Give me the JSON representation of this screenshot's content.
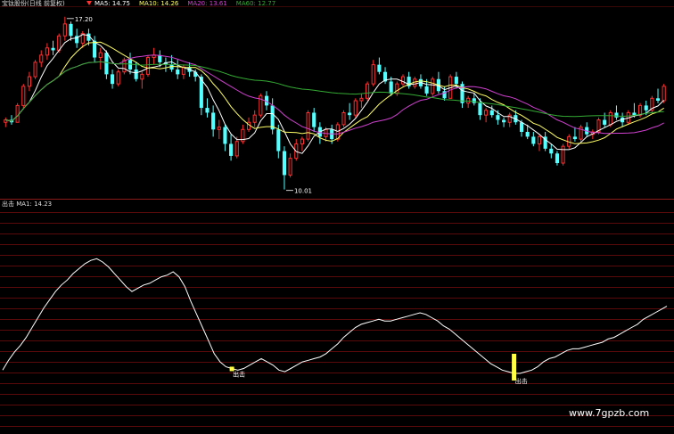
{
  "chart_data": [
    {
      "type": "candlestick",
      "title": "宝钛股份(日线 前复权)",
      "ma_legend": [
        {
          "label": "MA5: 14.75",
          "color": "#ffffff"
        },
        {
          "label": "MA10: 14.26",
          "color": "#ffff66"
        },
        {
          "label": "MA20: 13.61",
          "color": "#d040d0"
        },
        {
          "label": "MA60: 12.77",
          "color": "#33aa33"
        }
      ],
      "annotations": {
        "high": "17.20",
        "low": "10.01"
      },
      "ylim": [
        9.8,
        17.6
      ],
      "colors": {
        "up": "#ff3030",
        "down": "#54ffff",
        "grid": "#5a0a0a",
        "divider": "#8a1a1a"
      },
      "candles": [
        [
          12.8,
          13.0,
          12.6,
          12.9
        ],
        [
          12.9,
          13.1,
          12.7,
          12.8
        ],
        [
          12.8,
          13.6,
          12.8,
          13.5
        ],
        [
          13.5,
          14.4,
          13.4,
          14.3
        ],
        [
          14.3,
          14.9,
          14.1,
          14.7
        ],
        [
          14.7,
          15.4,
          14.6,
          15.3
        ],
        [
          15.3,
          15.8,
          15.1,
          15.6
        ],
        [
          15.6,
          16.1,
          15.4,
          15.9
        ],
        [
          15.9,
          16.2,
          15.6,
          15.8
        ],
        [
          15.8,
          16.5,
          15.7,
          16.4
        ],
        [
          16.4,
          17.2,
          16.2,
          16.9
        ],
        [
          16.9,
          17.0,
          16.2,
          16.4
        ],
        [
          16.4,
          16.7,
          15.9,
          16.1
        ],
        [
          16.1,
          16.6,
          15.9,
          16.5
        ],
        [
          16.5,
          16.7,
          16.0,
          16.2
        ],
        [
          16.2,
          16.4,
          15.3,
          15.5
        ],
        [
          15.5,
          15.9,
          15.0,
          15.7
        ],
        [
          15.7,
          15.8,
          14.6,
          14.8
        ],
        [
          14.8,
          15.0,
          14.2,
          14.4
        ],
        [
          14.4,
          15.0,
          14.3,
          14.9
        ],
        [
          14.9,
          15.5,
          14.8,
          15.4
        ],
        [
          15.4,
          15.7,
          14.8,
          15.0
        ],
        [
          15.0,
          15.3,
          14.5,
          14.6
        ],
        [
          14.6,
          14.9,
          14.2,
          14.8
        ],
        [
          14.8,
          15.6,
          14.7,
          15.5
        ],
        [
          15.5,
          15.9,
          15.2,
          15.6
        ],
        [
          15.6,
          15.8,
          15.1,
          15.3
        ],
        [
          15.3,
          15.5,
          14.9,
          15.2
        ],
        [
          15.2,
          15.6,
          14.9,
          15.0
        ],
        [
          15.0,
          15.4,
          14.6,
          14.8
        ],
        [
          14.8,
          15.2,
          14.6,
          15.1
        ],
        [
          15.1,
          15.3,
          14.7,
          14.9
        ],
        [
          14.9,
          15.0,
          14.5,
          14.7
        ],
        [
          14.7,
          14.8,
          13.1,
          13.4
        ],
        [
          13.4,
          13.8,
          13.0,
          13.2
        ],
        [
          13.2,
          13.5,
          12.2,
          12.5
        ],
        [
          12.5,
          12.9,
          12.1,
          12.6
        ],
        [
          12.6,
          12.7,
          11.6,
          11.9
        ],
        [
          11.9,
          12.3,
          11.2,
          11.4
        ],
        [
          11.4,
          12.2,
          11.3,
          12.0
        ],
        [
          12.0,
          12.7,
          11.9,
          12.5
        ],
        [
          12.5,
          13.0,
          12.4,
          12.8
        ],
        [
          12.8,
          13.3,
          12.6,
          13.1
        ],
        [
          13.1,
          14.0,
          13.0,
          13.9
        ],
        [
          13.9,
          14.1,
          13.3,
          13.5
        ],
        [
          13.5,
          13.8,
          12.3,
          12.5
        ],
        [
          12.5,
          12.7,
          11.3,
          11.6
        ],
        [
          11.6,
          11.8,
          10.0,
          10.6
        ],
        [
          10.6,
          11.5,
          10.5,
          11.3
        ],
        [
          11.3,
          12.1,
          11.2,
          11.9
        ],
        [
          11.9,
          12.2,
          11.6,
          12.1
        ],
        [
          12.1,
          13.3,
          12.0,
          13.2
        ],
        [
          13.2,
          13.4,
          12.4,
          12.6
        ],
        [
          12.6,
          12.8,
          11.9,
          12.2
        ],
        [
          12.2,
          12.6,
          12.0,
          12.5
        ],
        [
          12.5,
          12.7,
          11.9,
          12.1
        ],
        [
          12.1,
          12.8,
          12.0,
          12.7
        ],
        [
          12.7,
          13.3,
          12.6,
          13.2
        ],
        [
          13.2,
          13.6,
          12.9,
          13.1
        ],
        [
          13.1,
          13.8,
          13.0,
          13.7
        ],
        [
          13.7,
          14.0,
          13.4,
          13.8
        ],
        [
          13.8,
          14.5,
          13.7,
          14.4
        ],
        [
          14.4,
          15.4,
          14.3,
          15.2
        ],
        [
          15.2,
          15.5,
          14.8,
          14.9
        ],
        [
          14.9,
          15.1,
          14.4,
          14.5
        ],
        [
          14.5,
          14.7,
          13.9,
          14.0
        ],
        [
          14.0,
          14.5,
          13.9,
          14.4
        ],
        [
          14.4,
          14.8,
          14.3,
          14.7
        ],
        [
          14.7,
          14.9,
          14.2,
          14.3
        ],
        [
          14.3,
          14.7,
          14.2,
          14.6
        ],
        [
          14.6,
          14.8,
          14.2,
          14.3
        ],
        [
          14.3,
          14.6,
          13.9,
          14.0
        ],
        [
          14.0,
          14.7,
          13.9,
          14.6
        ],
        [
          14.6,
          14.9,
          14.0,
          14.1
        ],
        [
          14.1,
          14.3,
          13.7,
          13.8
        ],
        [
          13.8,
          14.8,
          13.8,
          14.7
        ],
        [
          14.7,
          14.9,
          14.2,
          14.4
        ],
        [
          14.4,
          14.5,
          13.4,
          13.6
        ],
        [
          13.6,
          13.9,
          13.4,
          13.8
        ],
        [
          13.8,
          14.0,
          13.5,
          13.6
        ],
        [
          13.6,
          13.8,
          12.9,
          13.1
        ],
        [
          13.1,
          13.4,
          12.8,
          13.3
        ],
        [
          13.3,
          13.5,
          13.0,
          13.1
        ],
        [
          13.1,
          13.3,
          12.7,
          12.9
        ],
        [
          12.9,
          13.0,
          12.6,
          12.8
        ],
        [
          12.8,
          13.2,
          12.6,
          13.1
        ],
        [
          13.1,
          13.3,
          12.7,
          12.8
        ],
        [
          12.8,
          12.9,
          12.2,
          12.4
        ],
        [
          12.4,
          12.7,
          12.1,
          12.2
        ],
        [
          12.2,
          12.4,
          11.8,
          11.9
        ],
        [
          11.9,
          12.3,
          11.6,
          12.2
        ],
        [
          12.2,
          12.4,
          11.6,
          11.7
        ],
        [
          11.7,
          11.9,
          11.3,
          11.5
        ],
        [
          11.5,
          11.6,
          11.0,
          11.1
        ],
        [
          11.1,
          11.9,
          11.0,
          11.8
        ],
        [
          11.8,
          12.3,
          11.7,
          12.2
        ],
        [
          12.2,
          12.6,
          12.0,
          12.1
        ],
        [
          12.1,
          12.7,
          12.0,
          12.6
        ],
        [
          12.6,
          12.8,
          12.2,
          12.3
        ],
        [
          12.3,
          12.5,
          12.1,
          12.4
        ],
        [
          12.4,
          13.0,
          12.3,
          12.9
        ],
        [
          12.9,
          13.2,
          12.6,
          12.7
        ],
        [
          12.7,
          13.3,
          12.6,
          13.2
        ],
        [
          13.2,
          13.5,
          12.9,
          13.0
        ],
        [
          13.0,
          13.2,
          12.6,
          12.8
        ],
        [
          12.8,
          13.3,
          12.7,
          13.2
        ],
        [
          13.2,
          13.6,
          13.0,
          13.1
        ],
        [
          13.1,
          13.6,
          13.0,
          13.5
        ],
        [
          13.5,
          13.7,
          13.1,
          13.3
        ],
        [
          13.3,
          13.9,
          13.2,
          13.8
        ],
        [
          13.8,
          14.2,
          13.6,
          13.7
        ],
        [
          13.7,
          14.4,
          13.6,
          14.3
        ]
      ],
      "ma_windows": [
        5,
        10,
        20,
        60
      ]
    },
    {
      "type": "line",
      "legend": "出击  MA1: 14.23",
      "series": [
        {
          "name": "MA1",
          "color": "#ffffff",
          "values": [
            10.8,
            11.4,
            11.9,
            12.3,
            12.8,
            13.4,
            14.0,
            14.6,
            15.1,
            15.6,
            16.0,
            16.3,
            16.7,
            17.0,
            17.3,
            17.5,
            17.6,
            17.4,
            17.1,
            16.7,
            16.3,
            15.9,
            15.6,
            15.8,
            16.0,
            16.1,
            16.3,
            16.5,
            16.6,
            16.8,
            16.5,
            15.9,
            15.0,
            14.2,
            13.4,
            12.6,
            11.8,
            11.3,
            11.0,
            10.9,
            10.8,
            10.9,
            11.1,
            11.3,
            11.5,
            11.3,
            11.1,
            10.8,
            10.7,
            10.9,
            11.1,
            11.3,
            11.4,
            11.5,
            11.6,
            11.8,
            12.1,
            12.4,
            12.8,
            13.1,
            13.4,
            13.6,
            13.7,
            13.8,
            13.9,
            13.8,
            13.8,
            13.9,
            14.0,
            14.1,
            14.2,
            14.3,
            14.2,
            14.0,
            13.8,
            13.5,
            13.3,
            13.0,
            12.7,
            12.4,
            12.1,
            11.8,
            11.5,
            11.2,
            11.0,
            10.8,
            10.7,
            10.6,
            10.6,
            10.7,
            10.8,
            11.0,
            11.3,
            11.5,
            11.6,
            11.8,
            12.0,
            12.1,
            12.1,
            12.2,
            12.3,
            12.4,
            12.5,
            12.7,
            12.8,
            13.0,
            13.2,
            13.4,
            13.6,
            13.9,
            14.1,
            14.3,
            14.5,
            14.7
          ]
        }
      ],
      "markers": [
        {
          "index": 39,
          "label": "出击",
          "color": "#ffff44",
          "bar_height": 0.0
        },
        {
          "index": 87,
          "label": "出击",
          "color": "#ffff44",
          "bar_height": 1.0
        }
      ],
      "ylim": [
        10.0,
        18.0
      ]
    }
  ],
  "watermark": "www.7gpzb.com"
}
